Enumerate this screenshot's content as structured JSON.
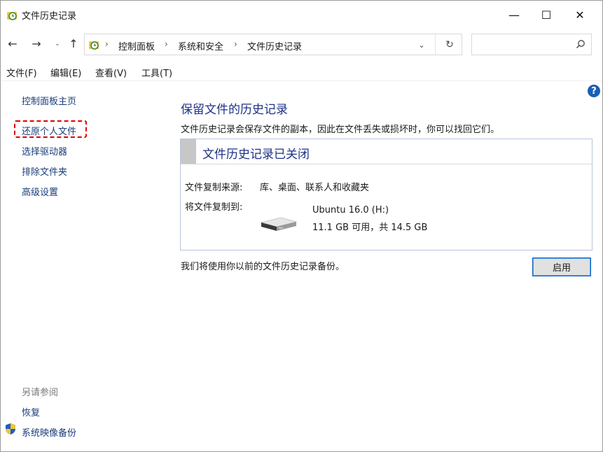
{
  "window": {
    "title": "文件历史记录",
    "controls": {
      "minimize": "—",
      "maximize": "☐",
      "close": "✕"
    }
  },
  "navigation": {
    "back": "←",
    "forward": "→",
    "recent": "⌄",
    "up": "↑",
    "breadcrumbs": [
      "控制面板",
      "系统和安全",
      "文件历史记录"
    ],
    "separator": "›",
    "dropdown": "⌄",
    "refresh": "↻",
    "search_placeholder": ""
  },
  "menu": [
    "文件(F)",
    "编辑(E)",
    "查看(V)",
    "工具(T)"
  ],
  "sidebar": {
    "links": [
      "控制面板主页",
      "还原个人文件",
      "选择驱动器",
      "排除文件夹",
      "高级设置"
    ],
    "see_also_heading": "另请参阅",
    "see_also": [
      "恢复",
      "系统映像备份"
    ]
  },
  "main": {
    "help": "?",
    "title": "保留文件的历史记录",
    "description": "文件历史记录会保存文件的副本，因此在文件丢失或损坏时，你可以找回它们。",
    "status_title": "文件历史记录已关闭",
    "copy_from_label": "文件复制来源:",
    "copy_from_value": "库、桌面、联系人和收藏夹",
    "copy_to_label": "将文件复制到:",
    "drive_name": "Ubuntu 16.0 (H:)",
    "drive_space": "11.1 GB 可用，共 14.5 GB",
    "backup_note": "我们将使用你以前的文件历史记录备份。",
    "enable_button": "启用"
  },
  "colors": {
    "link": "#1a3d7a",
    "heading": "#1e3287",
    "highlight_border": "#e00000",
    "button_border": "#0a64c8"
  }
}
